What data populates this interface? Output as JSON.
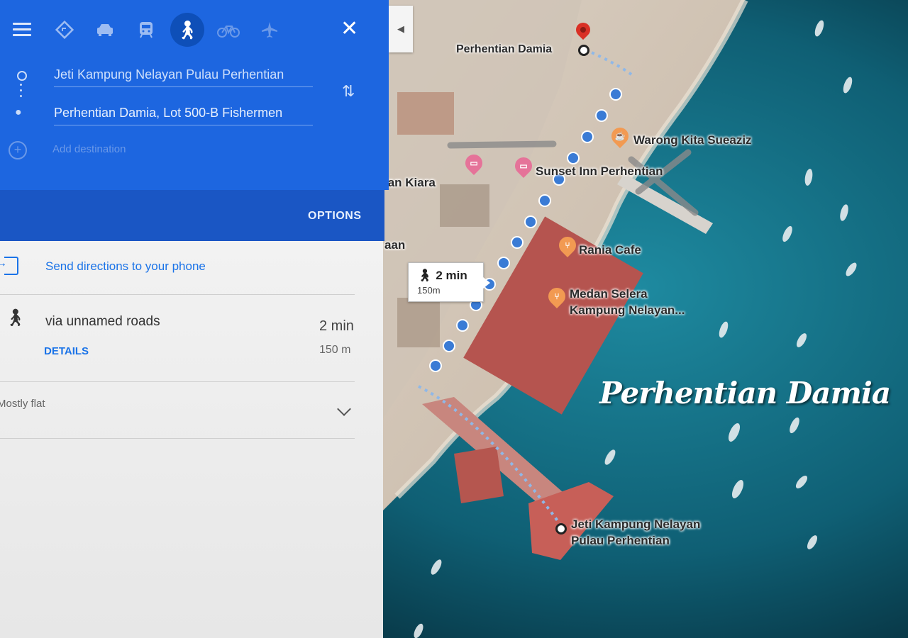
{
  "panel": {
    "modes": [
      {
        "name": "best-route",
        "icon": "diamond-route-icon"
      },
      {
        "name": "driving",
        "icon": "car-icon"
      },
      {
        "name": "transit",
        "icon": "train-icon"
      },
      {
        "name": "walking",
        "icon": "walk-icon",
        "active": true
      },
      {
        "name": "cycling",
        "icon": "bicycle-icon"
      },
      {
        "name": "flights",
        "icon": "airplane-icon"
      }
    ],
    "origin": "Jeti Kampung Nelayan Pulau Perhentian",
    "destination": "Perhentian Damia, Lot 500-B Fishermen",
    "add_destination": "Add destination",
    "options_label": "OPTIONS",
    "send_label": "Send directions to your phone",
    "route": {
      "via": "via unnamed roads",
      "duration": "2 min",
      "distance": "150 m",
      "details_label": "DETAILS"
    },
    "elevation_note": "Mostly flat"
  },
  "map": {
    "labels": {
      "destination": "Perhentian Damia",
      "warong": "Warong Kita Sueaziz",
      "sunset": "Sunset Inn Perhentian",
      "kiara": "ian Kiara",
      "aan": "aan",
      "rania": "Rania Cafe",
      "medan_line1": "Medan Selera",
      "medan_line2": "Kampung Nelayan...",
      "jetty_line1": "Jeti Kampung Nelayan",
      "jetty_line2": "Pulau Perhentian"
    },
    "route_bubble": {
      "duration": "2 min",
      "distance": "150m"
    },
    "watermark": "Perhentian Damia"
  },
  "colors": {
    "panel_blue": "#1d66e0",
    "options_bar_blue": "#1a56c4",
    "route_dot_blue": "#3a7bd5",
    "link_blue": "#1a73e8",
    "pin_orange": "#f29a52",
    "pin_pink": "#e57399",
    "pin_red": "#d93025"
  }
}
